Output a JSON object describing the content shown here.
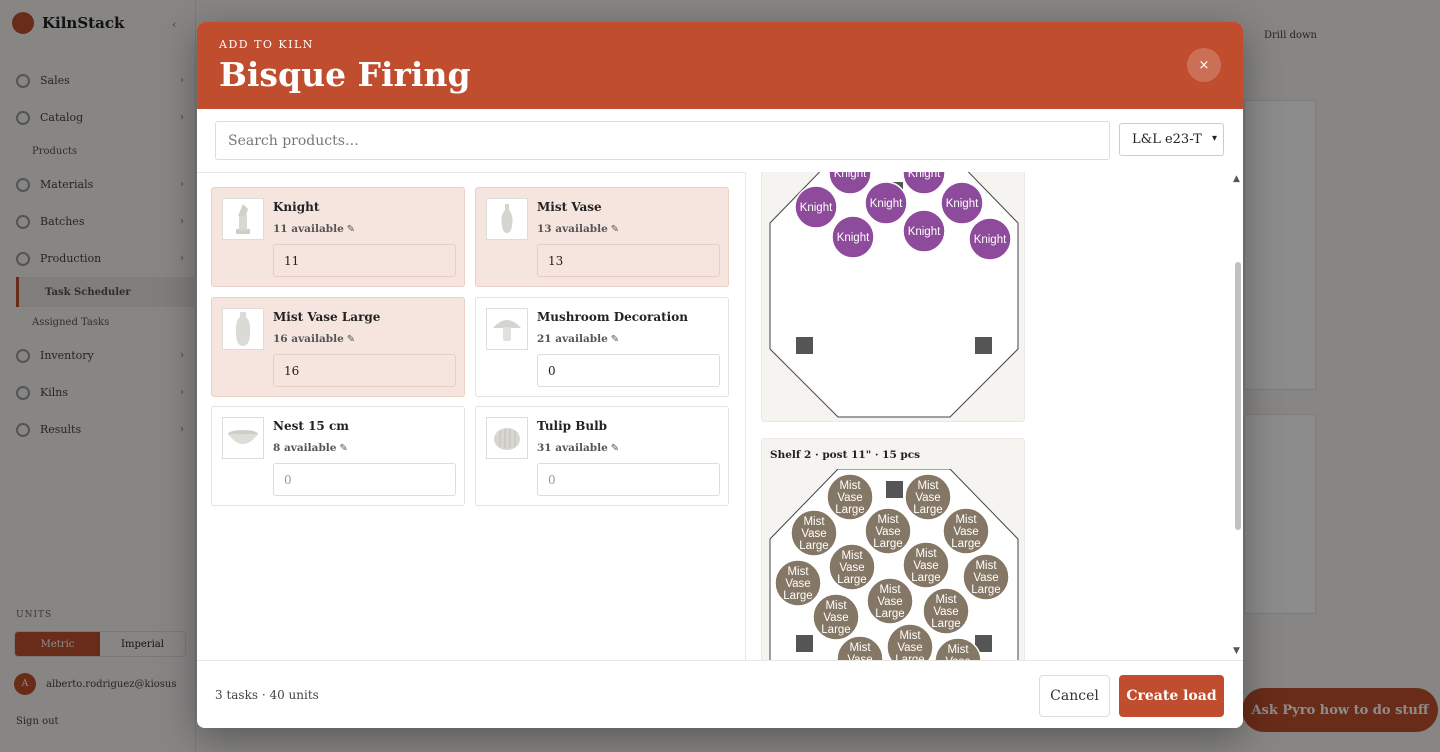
{
  "app": {
    "brand": "KilnStack",
    "nav": [
      {
        "label": "Sales"
      },
      {
        "label": "Catalog"
      },
      {
        "label": "Materials"
      },
      {
        "label": "Batches"
      },
      {
        "label": "Production"
      },
      {
        "label": "Inventory"
      },
      {
        "label": "Kilns"
      },
      {
        "label": "Results"
      }
    ],
    "nav_sub": {
      "products": "Products",
      "task_scheduler": "Task Scheduler",
      "assigned_tasks": "Assigned Tasks"
    },
    "units_label": "UNITS",
    "units": {
      "metric": "Metric",
      "imperial": "Imperial"
    },
    "user_email": "alberto.rodriguez@kiosus",
    "user_initial": "A",
    "sign_out": "Sign out",
    "top_right_hint": "Drill down",
    "ask_prompt": "Ask Pyro how to do stuff"
  },
  "modal": {
    "eyebrow": "ADD TO KILN",
    "title": "Bisque Firing",
    "close": "×",
    "search": {
      "placeholder": "Search products…",
      "value": ""
    },
    "kiln_select": {
      "value": "L&L e23-T"
    },
    "products": [
      {
        "name": "Knight",
        "available": "11 available",
        "qty": "11",
        "placeholder": "0",
        "selected": true,
        "icon": "knight-figurine-thumbnail"
      },
      {
        "name": "Mist Vase",
        "available": "13 available",
        "qty": "13",
        "placeholder": "0",
        "selected": true,
        "icon": "vase-thumbnail"
      },
      {
        "name": "Mist Vase Large",
        "available": "16 available",
        "qty": "16",
        "placeholder": "0",
        "selected": true,
        "icon": "tall-vase-thumbnail"
      },
      {
        "name": "Mushroom Decoration",
        "available": "21 available",
        "qty": "0",
        "placeholder": "0",
        "selected": false,
        "icon": "mushroom-thumbnail"
      },
      {
        "name": "Nest 15 cm",
        "available": "8 available",
        "qty": "",
        "placeholder": "0",
        "selected": false,
        "icon": "bowl-thumbnail"
      },
      {
        "name": "Tulip Bulb",
        "available": "31 available",
        "qty": "",
        "placeholder": "0",
        "selected": false,
        "icon": "tulip-bulb-thumbnail"
      }
    ],
    "shelves": [
      {
        "label": "",
        "piece": "Knight",
        "color": "#8e4b9b"
      },
      {
        "label": "Shelf 2 · post 11\" · 15 pcs",
        "piece": "Mist Vase Large",
        "color": "#857765"
      }
    ],
    "footer": {
      "summary": "3 tasks · 40 units",
      "cancel": "Cancel",
      "create": "Create load"
    }
  },
  "colors": {
    "accent": "#bf4d2e",
    "selected_card": "#f6e5df",
    "knight_piece": "#8e4b9b",
    "vase_piece": "#857765",
    "post": "#555555"
  }
}
